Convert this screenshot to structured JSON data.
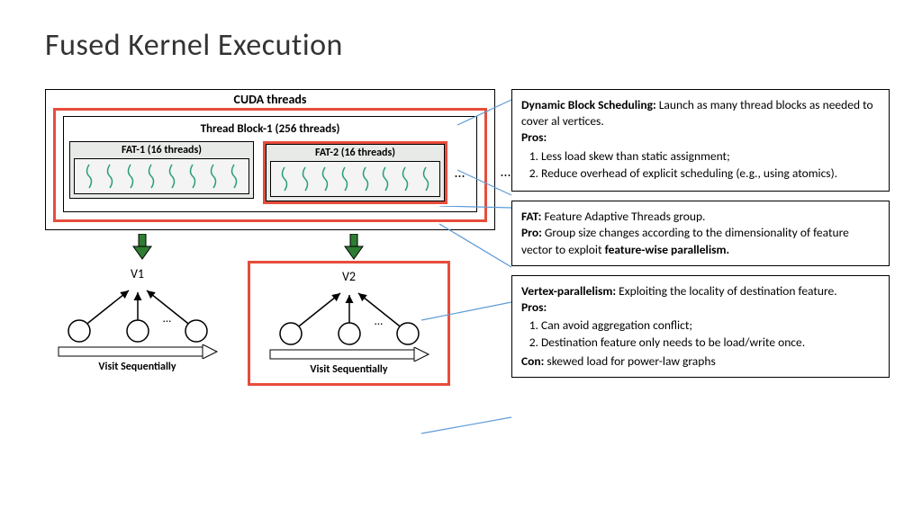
{
  "title": "Fused Kernel Execution",
  "diagram": {
    "cuda_label": "CUDA threads",
    "thread_block_label": "Thread Block-1 (256 threads)",
    "fat1_label": "FAT-1 (16 threads)",
    "fat2_label": "FAT-2 (16 threads)",
    "ellipsis": "…",
    "ellipsis2": "…",
    "v1_label": "V1",
    "v2_label": "V2",
    "graph_ellipsis": "…",
    "visit_label": "Visit Sequentially"
  },
  "box1": {
    "heading": "Dynamic Block Scheduling:",
    "desc": " Launch as many thread blocks as needed to cover al vertices.",
    "pros_label": "Pros:",
    "pro1": "Less load skew than static assignment;",
    "pro2": "Reduce overhead of explicit scheduling (e.g., using atomics)."
  },
  "box2": {
    "heading": "FAT:",
    "desc": " Feature Adaptive Threads group.",
    "pro_label": "Pro:",
    "pro_text": " Group size changes according to the dimensionality of feature vector to exploit ",
    "emphasis": "feature-wise parallelism."
  },
  "box3": {
    "heading": "Vertex-parallelism:",
    "desc": " Exploiting the locality of destination feature.",
    "pros_label": "Pros:",
    "pro1": "Can avoid aggregation conflict;",
    "pro2": "Destination feature only needs to be load/write once.",
    "con_label": "Con:",
    "con_text": " skewed load for power-law graphs"
  }
}
